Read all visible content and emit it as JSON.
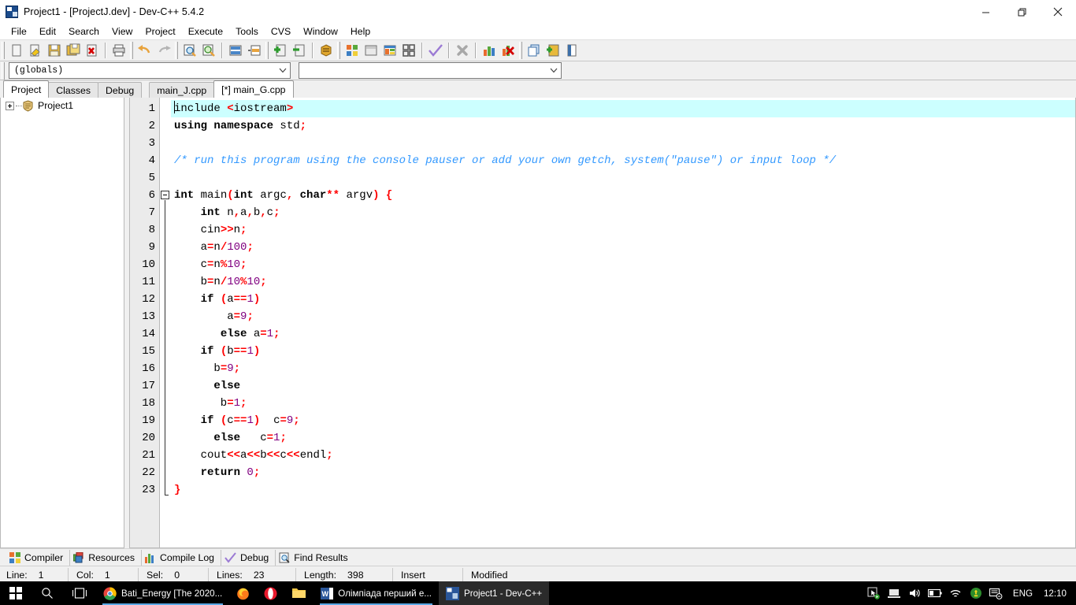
{
  "window": {
    "title": "Project1 - [ProjectJ.dev] - Dev-C++ 5.4.2",
    "icon": "devcpp-icon",
    "controls": {
      "minimize": "minimize-icon",
      "restore": "restore-icon",
      "close": "close-icon"
    }
  },
  "menubar": {
    "items": [
      "File",
      "Edit",
      "Search",
      "View",
      "Project",
      "Execute",
      "Tools",
      "CVS",
      "Window",
      "Help"
    ]
  },
  "toolbar": {
    "groups": [
      {
        "buttons": [
          "new-file-icon",
          "open-file-icon",
          "save-icon",
          "save-all-icon",
          "close-file-icon"
        ]
      },
      {
        "buttons": [
          "print-icon"
        ]
      },
      {
        "buttons": [
          "undo-icon",
          "redo-icon"
        ]
      },
      {
        "buttons": [
          "find-icon",
          "replace-icon"
        ]
      },
      {
        "buttons": [
          "goto-line-icon",
          "goto-function-icon"
        ]
      },
      {
        "buttons": [
          "add-bookmark-icon",
          "remove-bookmark-icon"
        ]
      },
      {
        "buttons": [
          "insert-icon"
        ]
      },
      {
        "buttons": [
          "new-project-icon",
          "project-options-icon",
          "compile-icon",
          "compile-run-icon"
        ]
      },
      {
        "buttons": [
          "run-check-icon"
        ]
      },
      {
        "buttons": [
          "stop-icon"
        ]
      },
      {
        "buttons": [
          "profile-icon",
          "debug-icon"
        ]
      },
      {
        "buttons": [
          "window-list-icon",
          "add-window-icon",
          "close-window-icon"
        ]
      }
    ]
  },
  "combos": {
    "scope": {
      "value": "(globals)",
      "arrow": "chevron-down-icon"
    },
    "member": {
      "value": "",
      "arrow": "chevron-down-icon"
    }
  },
  "left_panel": {
    "tabs": [
      {
        "label": "Project",
        "active": true
      },
      {
        "label": "Classes",
        "active": false
      },
      {
        "label": "Debug",
        "active": false
      }
    ],
    "tree": [
      {
        "label": "Project1",
        "icon": "project-icon",
        "expander": "expand-plus-icon"
      }
    ]
  },
  "editor": {
    "tabs": [
      {
        "label": "main_J.cpp",
        "active": false
      },
      {
        "label": "[*] main_G.cpp",
        "active": true
      }
    ],
    "current_line": 1,
    "lines": [
      {
        "n": 1,
        "highlight": true,
        "caret": true,
        "tokens": [
          {
            "t": "include ",
            "c": "pln"
          },
          {
            "t": "<",
            "c": "op"
          },
          {
            "t": "iostream",
            "c": "pln"
          },
          {
            "t": ">",
            "c": "op"
          }
        ]
      },
      {
        "n": 2,
        "tokens": [
          {
            "t": "using namespace ",
            "c": "kw"
          },
          {
            "t": "std",
            "c": "pln"
          },
          {
            "t": ";",
            "c": "op"
          }
        ]
      },
      {
        "n": 3,
        "tokens": []
      },
      {
        "n": 4,
        "tokens": [
          {
            "t": "/* run this program using the console pauser or add your own getch, system(\"pause\") or input loop */",
            "c": "cmt"
          }
        ]
      },
      {
        "n": 5,
        "tokens": []
      },
      {
        "n": 6,
        "fold": "open",
        "tokens": [
          {
            "t": "int ",
            "c": "kw"
          },
          {
            "t": "main",
            "c": "pln"
          },
          {
            "t": "(",
            "c": "op"
          },
          {
            "t": "int ",
            "c": "kw"
          },
          {
            "t": "argc",
            "c": "pln"
          },
          {
            "t": ", ",
            "c": "op"
          },
          {
            "t": "char",
            "c": "kw"
          },
          {
            "t": "** ",
            "c": "op"
          },
          {
            "t": "argv",
            "c": "pln"
          },
          {
            "t": ")",
            "c": "op"
          },
          {
            "t": " ",
            "c": "pln"
          },
          {
            "t": "{",
            "c": "op"
          }
        ]
      },
      {
        "n": 7,
        "tokens": [
          {
            "t": "    ",
            "c": "pln"
          },
          {
            "t": "int ",
            "c": "kw"
          },
          {
            "t": "n",
            "c": "pln"
          },
          {
            "t": ",",
            "c": "op"
          },
          {
            "t": "a",
            "c": "pln"
          },
          {
            "t": ",",
            "c": "op"
          },
          {
            "t": "b",
            "c": "pln"
          },
          {
            "t": ",",
            "c": "op"
          },
          {
            "t": "c",
            "c": "pln"
          },
          {
            "t": ";",
            "c": "op"
          }
        ]
      },
      {
        "n": 8,
        "tokens": [
          {
            "t": "    cin",
            "c": "pln"
          },
          {
            "t": ">>",
            "c": "op"
          },
          {
            "t": "n",
            "c": "pln"
          },
          {
            "t": ";",
            "c": "op"
          }
        ]
      },
      {
        "n": 9,
        "tokens": [
          {
            "t": "    a",
            "c": "pln"
          },
          {
            "t": "=",
            "c": "op"
          },
          {
            "t": "n",
            "c": "pln"
          },
          {
            "t": "/",
            "c": "op"
          },
          {
            "t": "100",
            "c": "num"
          },
          {
            "t": ";",
            "c": "op"
          }
        ]
      },
      {
        "n": 10,
        "tokens": [
          {
            "t": "    c",
            "c": "pln"
          },
          {
            "t": "=",
            "c": "op"
          },
          {
            "t": "n",
            "c": "pln"
          },
          {
            "t": "%",
            "c": "op"
          },
          {
            "t": "10",
            "c": "num"
          },
          {
            "t": ";",
            "c": "op"
          }
        ]
      },
      {
        "n": 11,
        "tokens": [
          {
            "t": "    b",
            "c": "pln"
          },
          {
            "t": "=",
            "c": "op"
          },
          {
            "t": "n",
            "c": "pln"
          },
          {
            "t": "/",
            "c": "op"
          },
          {
            "t": "10",
            "c": "num"
          },
          {
            "t": "%",
            "c": "op"
          },
          {
            "t": "10",
            "c": "num"
          },
          {
            "t": ";",
            "c": "op"
          }
        ]
      },
      {
        "n": 12,
        "tokens": [
          {
            "t": "    ",
            "c": "pln"
          },
          {
            "t": "if ",
            "c": "kw"
          },
          {
            "t": "(",
            "c": "op"
          },
          {
            "t": "a",
            "c": "pln"
          },
          {
            "t": "==",
            "c": "op"
          },
          {
            "t": "1",
            "c": "num"
          },
          {
            "t": ")",
            "c": "op"
          }
        ]
      },
      {
        "n": 13,
        "tokens": [
          {
            "t": "        a",
            "c": "pln"
          },
          {
            "t": "=",
            "c": "op"
          },
          {
            "t": "9",
            "c": "num"
          },
          {
            "t": ";",
            "c": "op"
          }
        ]
      },
      {
        "n": 14,
        "tokens": [
          {
            "t": "       ",
            "c": "pln"
          },
          {
            "t": "else ",
            "c": "kw"
          },
          {
            "t": "a",
            "c": "pln"
          },
          {
            "t": "=",
            "c": "op"
          },
          {
            "t": "1",
            "c": "num"
          },
          {
            "t": ";",
            "c": "op"
          }
        ]
      },
      {
        "n": 15,
        "tokens": [
          {
            "t": "    ",
            "c": "pln"
          },
          {
            "t": "if ",
            "c": "kw"
          },
          {
            "t": "(",
            "c": "op"
          },
          {
            "t": "b",
            "c": "pln"
          },
          {
            "t": "==",
            "c": "op"
          },
          {
            "t": "1",
            "c": "num"
          },
          {
            "t": ")",
            "c": "op"
          }
        ]
      },
      {
        "n": 16,
        "tokens": [
          {
            "t": "      b",
            "c": "pln"
          },
          {
            "t": "=",
            "c": "op"
          },
          {
            "t": "9",
            "c": "num"
          },
          {
            "t": ";",
            "c": "op"
          }
        ]
      },
      {
        "n": 17,
        "tokens": [
          {
            "t": "      ",
            "c": "pln"
          },
          {
            "t": "else",
            "c": "kw"
          }
        ]
      },
      {
        "n": 18,
        "tokens": [
          {
            "t": "       b",
            "c": "pln"
          },
          {
            "t": "=",
            "c": "op"
          },
          {
            "t": "1",
            "c": "num"
          },
          {
            "t": ";",
            "c": "op"
          }
        ]
      },
      {
        "n": 19,
        "tokens": [
          {
            "t": "    ",
            "c": "pln"
          },
          {
            "t": "if ",
            "c": "kw"
          },
          {
            "t": "(",
            "c": "op"
          },
          {
            "t": "c",
            "c": "pln"
          },
          {
            "t": "==",
            "c": "op"
          },
          {
            "t": "1",
            "c": "num"
          },
          {
            "t": ")",
            "c": "op"
          },
          {
            "t": "  c",
            "c": "pln"
          },
          {
            "t": "=",
            "c": "op"
          },
          {
            "t": "9",
            "c": "num"
          },
          {
            "t": ";",
            "c": "op"
          }
        ]
      },
      {
        "n": 20,
        "tokens": [
          {
            "t": "      ",
            "c": "pln"
          },
          {
            "t": "else",
            "c": "kw"
          },
          {
            "t": "   c",
            "c": "pln"
          },
          {
            "t": "=",
            "c": "op"
          },
          {
            "t": "1",
            "c": "num"
          },
          {
            "t": ";",
            "c": "op"
          }
        ]
      },
      {
        "n": 21,
        "tokens": [
          {
            "t": "    cout",
            "c": "pln"
          },
          {
            "t": "<<",
            "c": "op"
          },
          {
            "t": "a",
            "c": "pln"
          },
          {
            "t": "<<",
            "c": "op"
          },
          {
            "t": "b",
            "c": "pln"
          },
          {
            "t": "<<",
            "c": "op"
          },
          {
            "t": "c",
            "c": "pln"
          },
          {
            "t": "<<",
            "c": "op"
          },
          {
            "t": "endl",
            "c": "pln"
          },
          {
            "t": ";",
            "c": "op"
          }
        ]
      },
      {
        "n": 22,
        "tokens": [
          {
            "t": "    ",
            "c": "pln"
          },
          {
            "t": "return ",
            "c": "kw"
          },
          {
            "t": "0",
            "c": "num"
          },
          {
            "t": ";",
            "c": "op"
          }
        ]
      },
      {
        "n": 23,
        "fold": "end",
        "tokens": [
          {
            "t": "}",
            "c": "op"
          }
        ]
      }
    ]
  },
  "bottom_tabs": [
    {
      "label": "Compiler",
      "icon": "compiler-icon"
    },
    {
      "label": "Resources",
      "icon": "resources-icon"
    },
    {
      "label": "Compile Log",
      "icon": "compile-log-icon"
    },
    {
      "label": "Debug",
      "icon": "debug-check-icon"
    },
    {
      "label": "Find Results",
      "icon": "find-results-icon"
    }
  ],
  "statusbar": {
    "cells": [
      {
        "label": "Line:",
        "value": "1"
      },
      {
        "label": "Col:",
        "value": "1"
      },
      {
        "label": "Sel:",
        "value": "0"
      },
      {
        "label": "Lines:",
        "value": "23"
      },
      {
        "label": "Length:",
        "value": "398"
      },
      {
        "label": "Insert",
        "value": ""
      },
      {
        "label": "Modified",
        "value": ""
      }
    ]
  },
  "taskbar": {
    "start": "windows-start-icon",
    "search": "search-icon",
    "taskview": "task-view-icon",
    "items": [
      {
        "label": "Bati_Energy [The 2020...",
        "icon": "chrome-icon",
        "active": false,
        "running": true
      },
      {
        "label": "",
        "icon": "firefox-icon",
        "active": false,
        "running": false
      },
      {
        "label": "",
        "icon": "opera-icon",
        "active": false,
        "running": false
      },
      {
        "label": "",
        "icon": "file-explorer-icon",
        "active": false,
        "running": false
      },
      {
        "label": "Олімпіада перший е...",
        "icon": "word-icon",
        "active": false,
        "running": true
      },
      {
        "label": "Project1 - Dev-C++",
        "icon": "devcpp-icon",
        "active": true,
        "running": true
      }
    ],
    "tray": [
      "pointer-icon",
      "display-icon",
      "volume-icon",
      "battery-icon",
      "wifi-icon",
      "update-icon",
      "action-center-icon"
    ],
    "language": "ENG",
    "clock": "12:10"
  }
}
